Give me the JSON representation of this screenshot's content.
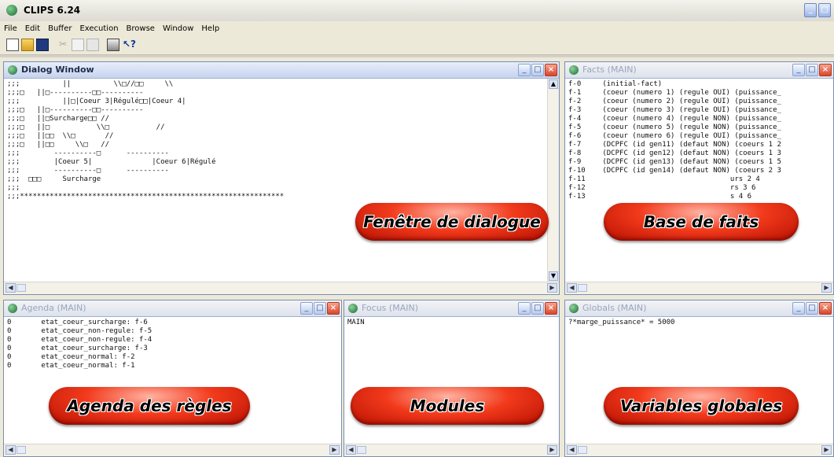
{
  "app": {
    "title": "CLIPS 6.24"
  },
  "menu": [
    "File",
    "Edit",
    "Buffer",
    "Execution",
    "Browse",
    "Window",
    "Help"
  ],
  "toolbar": [
    "new-file-icon",
    "open-folder-icon",
    "save-icon",
    "cut-icon",
    "copy-icon",
    "paste-icon",
    "print-icon",
    "help-pointer-icon"
  ],
  "dialog": {
    "title": "Dialog Window",
    "lines": [
      ";;;          ||          \\\\□//□□     \\\\",
      ";;;□   ||□----------□□----------",
      ";;;          ||□|Coeur 3|Régulé□□|Coeur 4|",
      ";;;□   ||□----------□□----------",
      ";;;□   ||□Surcharge□□ //",
      ";;;□   ||□           \\\\□           //",
      ";;;□   ||□□  \\\\□       //",
      ";;;□   ||□□     \\\\□   //",
      ";;;        ----------□      ----------",
      ";;;        |Coeur 5|              |Coeur 6|Régulé",
      ";;;        ----------□      ----------",
      ";;;  □□□     Surcharge",
      ";;;",
      ";;;**************************************************************"
    ]
  },
  "facts": {
    "title": "Facts (MAIN)",
    "lines": [
      "f-0     (initial-fact)",
      "f-1     (coeur (numero 1) (regule OUI) (puissance_",
      "f-2     (coeur (numero 2) (regule OUI) (puissance_",
      "f-3     (coeur (numero 3) (regule OUI) (puissance_",
      "f-4     (coeur (numero 4) (regule NON) (puissance_",
      "f-5     (coeur (numero 5) (regule NON) (puissance_",
      "f-6     (coeur (numero 6) (regule OUI) (puissance_",
      "f-7     (DCPFC (id gen11) (defaut NON) (coeurs 1 2",
      "f-8     (DCPFC (id gen12) (defaut NON) (coeurs 1 3",
      "f-9     (DCPFC (id gen13) (defaut NON) (coeurs 1 5",
      "f-10    (DCPFC (id gen14) (defaut NON) (coeurs 2 3",
      "f-11                                  urs 2 4",
      "f-12                                  rs 3 6",
      "f-13                                  s 4 6"
    ]
  },
  "agenda": {
    "title": "Agenda (MAIN)",
    "lines": [
      "0       etat_coeur_surcharge: f-6",
      "0       etat_coeur_non-regule: f-5",
      "0       etat_coeur_non-regule: f-4",
      "0       etat_coeur_surcharge: f-3",
      "0       etat_coeur_normal: f-2",
      "0       etat_coeur_normal: f-1"
    ]
  },
  "focus": {
    "title": "Focus (MAIN)",
    "lines": [
      "MAIN"
    ]
  },
  "globals": {
    "title": "Globals (MAIN)",
    "lines": [
      "?*marge_puissance* = 5000"
    ]
  },
  "annotations": {
    "dialog": "Fenêtre de dialogue",
    "facts": "Base de faits",
    "agenda": "Agenda des règles",
    "modules": "Modules",
    "globals": "Variables globales"
  }
}
